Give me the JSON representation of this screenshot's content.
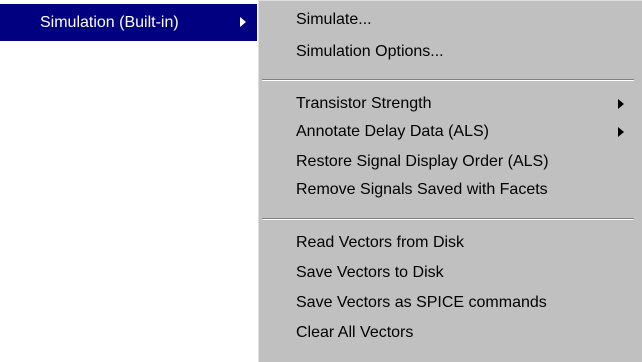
{
  "parent_menu": {
    "selected_label": "Simulation (Built-in)"
  },
  "submenu": {
    "groups": [
      [
        {
          "label": "Simulate...",
          "has_submenu": false
        },
        {
          "label": "Simulation Options...",
          "has_submenu": false
        }
      ],
      [
        {
          "label": "Transistor Strength",
          "has_submenu": true
        },
        {
          "label": "Annotate Delay Data (ALS)",
          "has_submenu": true
        },
        {
          "label": "Restore Signal Display Order (ALS)",
          "has_submenu": false
        },
        {
          "label": "Remove Signals Saved with Facets",
          "has_submenu": false
        }
      ],
      [
        {
          "label": "Read Vectors from Disk",
          "has_submenu": false
        },
        {
          "label": "Save Vectors to Disk",
          "has_submenu": false
        },
        {
          "label": "Save Vectors as SPICE commands",
          "has_submenu": false
        },
        {
          "label": "Clear All Vectors",
          "has_submenu": false
        }
      ]
    ]
  },
  "colors": {
    "highlight": "#000080",
    "menu_background": "#c0c0c0"
  }
}
